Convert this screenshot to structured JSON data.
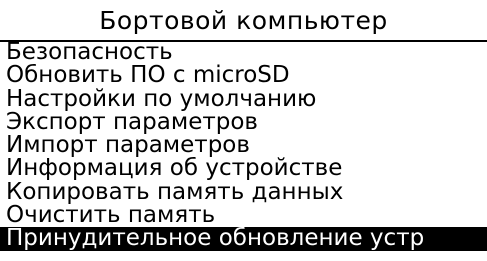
{
  "header": {
    "title": "Бортовой компьютер"
  },
  "menu": {
    "items": [
      {
        "label": "Безопасность"
      },
      {
        "label": "Обновить ПО с microSD"
      },
      {
        "label": "Настройки по умолчанию"
      },
      {
        "label": "Экспорт параметров"
      },
      {
        "label": "Импорт параметров"
      },
      {
        "label": "Информация об устройстве"
      },
      {
        "label": "Копировать память данных"
      },
      {
        "label": "Очистить память"
      },
      {
        "label": "Принудительное обновление устр"
      }
    ],
    "selected_label": "Принудительное обновление устр"
  },
  "colors": {
    "background": "#ffffff",
    "text": "#000000",
    "selection_background": "#000000",
    "selection_text": "#ffffff"
  }
}
